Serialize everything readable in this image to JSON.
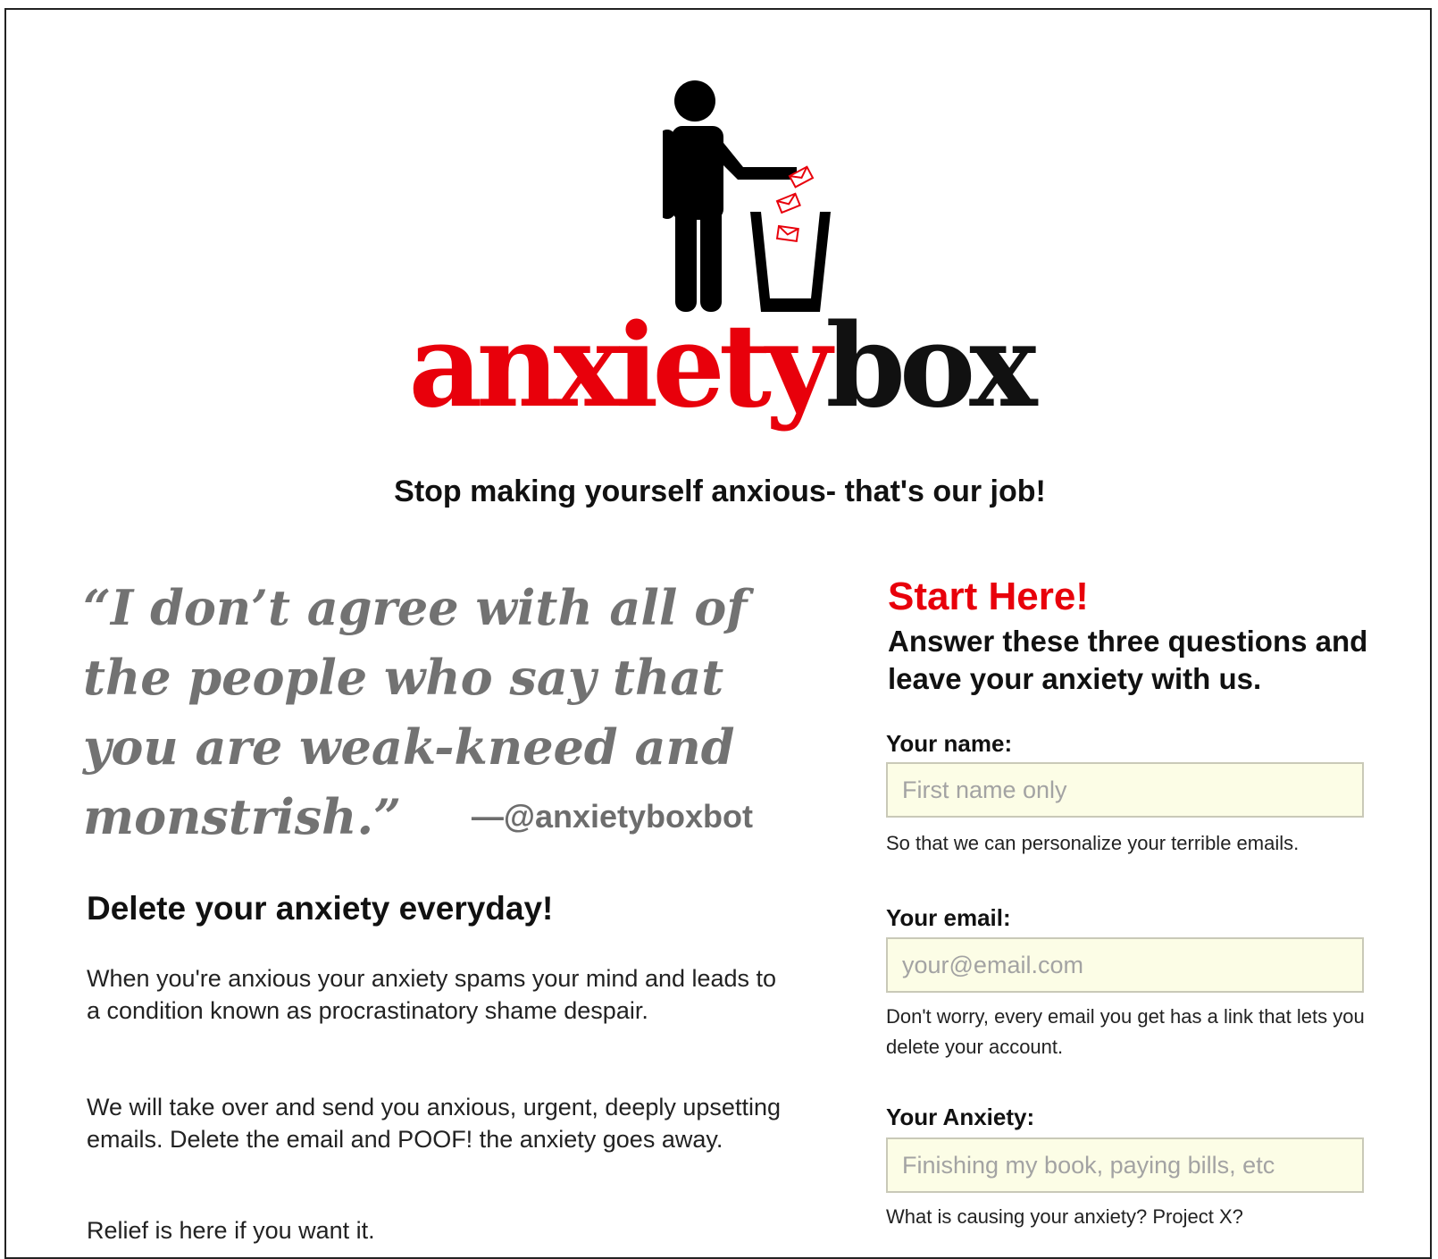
{
  "logo": {
    "word1": "anxiety",
    "word2": "box",
    "colors": {
      "red": "#e8000b",
      "black": "#111111"
    }
  },
  "hero_graphic": {
    "icon": "person-trash-can-icon",
    "envelope_color": "#e8000b"
  },
  "tagline": "Stop making yourself anxious- that's our job!",
  "quote": {
    "text": "“I don’t agree with all of the people who say that you are weak-kneed and monstrish.”",
    "attribution": "—@anxietyboxbot"
  },
  "intro": {
    "heading": "Delete your anxiety everyday!",
    "paragraphs": [
      "When you're anxious your anxiety spams your mind and leads to a condition known as procrastinatory shame despair.",
      "We will take over and send you anxious, urgent, deeply upsetting emails. Delete the email and POOF! the anxiety goes away.",
      "Relief is here if you want it."
    ]
  },
  "signup": {
    "heading": "Start Here!",
    "subheading": "Answer these three questions and leave your anxiety with us.",
    "fields": [
      {
        "label": "Your name:",
        "placeholder": "First name only",
        "help": "So that we can personalize your terrible emails."
      },
      {
        "label": "Your email:",
        "placeholder": "your@email.com",
        "help": "Don't worry, every email you get has a link that lets you delete your account."
      },
      {
        "label": "Your Anxiety:",
        "placeholder": "Finishing my book, paying bills, etc",
        "help": "What is causing your anxiety? Project X?"
      }
    ]
  }
}
